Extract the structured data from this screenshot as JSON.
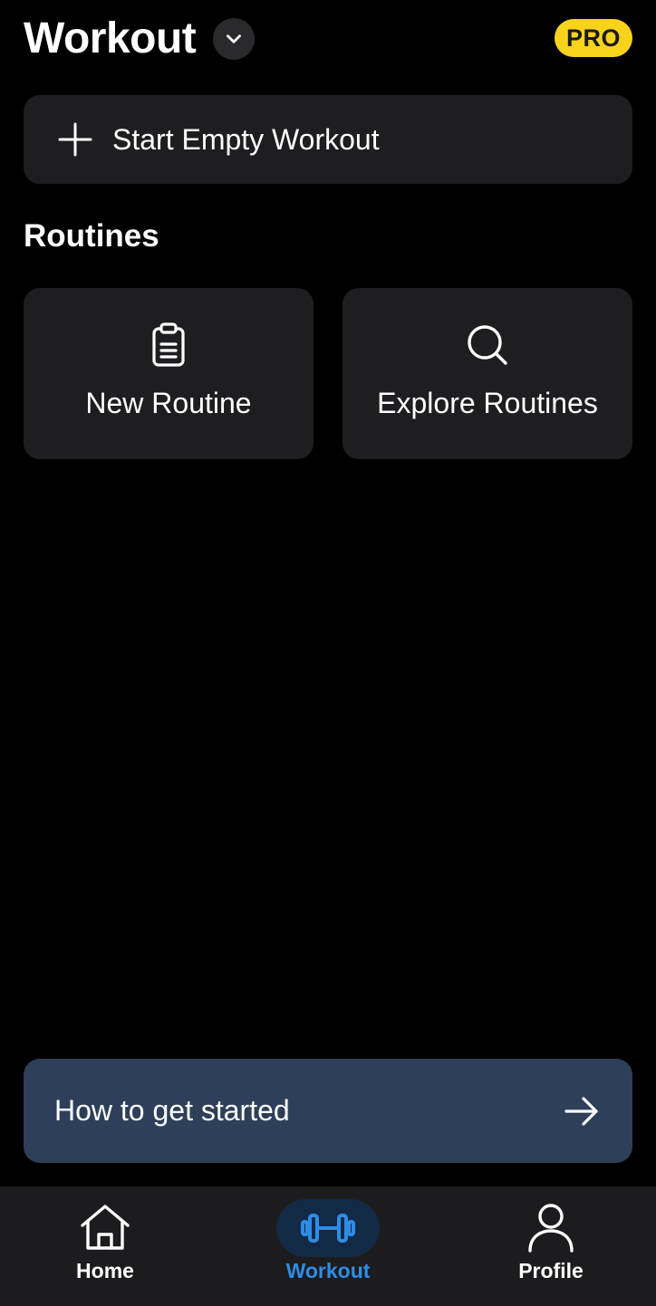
{
  "header": {
    "title": "Workout",
    "badge": "PRO"
  },
  "start_workout": {
    "label": "Start Empty Workout",
    "icon": "plus-icon"
  },
  "routines": {
    "section_title": "Routines",
    "cards": [
      {
        "label": "New Routine",
        "icon": "clipboard-icon"
      },
      {
        "label": "Explore Routines",
        "icon": "search-icon"
      }
    ]
  },
  "banner": {
    "label": "How to get started",
    "icon": "arrow-right-icon"
  },
  "bottom_nav": {
    "items": [
      {
        "label": "Home",
        "icon": "home-icon",
        "active": false
      },
      {
        "label": "Workout",
        "icon": "dumbbell-icon",
        "active": true
      },
      {
        "label": "Profile",
        "icon": "user-icon",
        "active": false
      }
    ]
  },
  "colors": {
    "background": "#000000",
    "card": "#1e1e20",
    "badge": "#f7d31b",
    "banner": "#2e4059",
    "accent": "#2f8ce6",
    "nav_background": "#1c1c1e"
  }
}
